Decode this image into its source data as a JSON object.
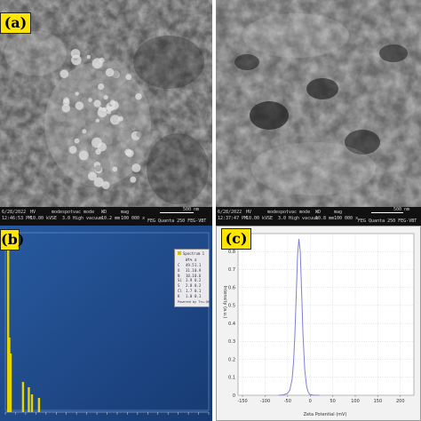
{
  "panel_a": {
    "label": "(a)",
    "info": {
      "date_time": [
        "6/28/2022",
        "12:46:53 PM"
      ],
      "hv": [
        "HV",
        "10.00 kV"
      ],
      "mode": [
        "mode",
        "SE"
      ],
      "spot": [
        "spot",
        "3.0"
      ],
      "vac": [
        "vac mode",
        "High vacuum"
      ],
      "wd": [
        "WD",
        "10.2 mm"
      ],
      "mag": [
        "mag",
        "100 000 x"
      ],
      "scale": "500 nm",
      "instrument": "FEG Quanta 250 FEG-VBT"
    }
  },
  "panel_b_sem": {
    "info": {
      "date_time": [
        "6/28/2022",
        "12:37:47 PM"
      ],
      "hv": [
        "HV",
        "10.00 kV"
      ],
      "mode": [
        "mode",
        "SE"
      ],
      "spot": [
        "spot",
        "3.0"
      ],
      "vac": [
        "vac mode",
        "High vacuum"
      ],
      "wd": [
        "WD",
        "10.8 mm"
      ],
      "mag": [
        "mag",
        "100 000 x"
      ],
      "scale": "500 nm",
      "instrument": "FEG Quanta 250 FEG-VBT"
    }
  },
  "panel_edx": {
    "label": "(b)",
    "legend": {
      "title": "Spectrum 1",
      "header": [
        "",
        "Wt%",
        "σ"
      ],
      "rows": [
        [
          "C",
          "49.5",
          "1.1"
        ],
        [
          "O",
          "31.1",
          "0.9"
        ],
        [
          "N",
          "10.1",
          "0.6"
        ],
        [
          "Si",
          "3.9",
          "0.2"
        ],
        [
          "S",
          "2.8",
          "0.2"
        ],
        [
          "Cl",
          "1.7",
          "0.1"
        ],
        [
          "K",
          "1.0",
          "0.1"
        ]
      ],
      "footer": "Powered by Tru-Q®"
    },
    "peaks": [
      {
        "energy": 0.28,
        "height": 0.98
      },
      {
        "energy": 0.39,
        "height": 0.42
      },
      {
        "energy": 0.52,
        "height": 0.33
      },
      {
        "energy": 1.74,
        "height": 0.17
      },
      {
        "energy": 2.31,
        "height": 0.14
      },
      {
        "energy": 2.62,
        "height": 0.1
      },
      {
        "energy": 3.31,
        "height": 0.08
      }
    ]
  },
  "panel_c": {
    "label": "(c)",
    "chart_data": {
      "type": "line",
      "xlabel": "Zeta Potential (mV)",
      "ylabel": "Intensity (a.u.)",
      "xlim": [
        -160,
        230
      ],
      "ylim": [
        0,
        0.9
      ],
      "x_ticks": [
        "-150",
        "-100",
        "-50",
        "0",
        "50",
        "100",
        "150",
        "200"
      ],
      "x_tick_values": [
        -150,
        -100,
        -50,
        0,
        50,
        100,
        150,
        200
      ],
      "y_ticks": [
        "0",
        "0.1",
        "0.2",
        "0.3",
        "0.4",
        "0.5",
        "0.6",
        "0.7",
        "0.8"
      ],
      "y_tick_values": [
        0,
        0.1,
        0.2,
        0.3,
        0.4,
        0.5,
        0.6,
        0.7,
        0.8
      ],
      "series": [
        {
          "x": [
            -70,
            -60,
            -50,
            -45,
            -40,
            -37,
            -34,
            -31,
            -28,
            -25,
            -22,
            -19,
            -16,
            -12,
            -8,
            -4,
            0,
            10,
            20
          ],
          "y": [
            0,
            0.002,
            0.01,
            0.03,
            0.09,
            0.18,
            0.33,
            0.55,
            0.78,
            0.87,
            0.8,
            0.58,
            0.34,
            0.14,
            0.05,
            0.015,
            0.003,
            0.0,
            0.0
          ],
          "color": "#7f7fd4"
        }
      ]
    }
  }
}
